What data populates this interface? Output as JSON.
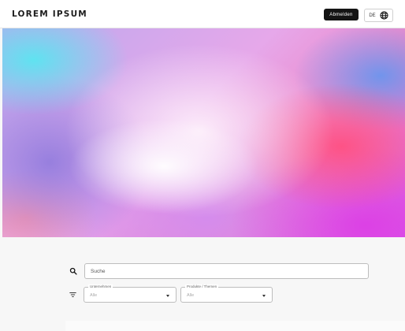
{
  "header": {
    "brand": "LOREM IPSUM",
    "logout_label": "Abmelden",
    "language_label": "DE"
  },
  "search": {
    "placeholder": "Suche"
  },
  "filters": {
    "company": {
      "label": "Unternehmen",
      "value": "Alle"
    },
    "products": {
      "label": "Produkte / Themen",
      "value": "Alle"
    }
  },
  "icons": {
    "search": "search-icon",
    "filter": "filter-icon",
    "language": "globe-icon",
    "dropdown": "chevron-down-icon"
  },
  "colors": {
    "primary_button": "#141414",
    "header_bg": "#ffffff",
    "page_bg": "#f7f7f7"
  }
}
